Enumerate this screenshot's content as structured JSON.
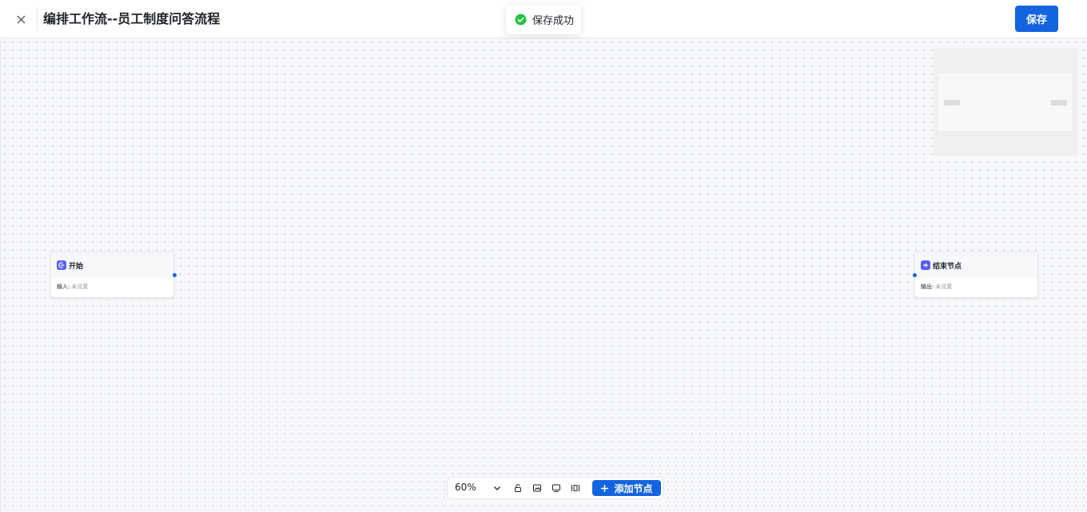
{
  "header": {
    "title": "编排工作流--员工制度问答流程",
    "close_icon": "close-icon",
    "save_label": "保存"
  },
  "toast": {
    "icon": "check-circle-icon",
    "message": "保存成功",
    "color": "#23c343"
  },
  "nodes": {
    "start": {
      "icon": "start-node-icon",
      "title": "开始",
      "field_label": "输入:",
      "field_value": "未设置"
    },
    "end": {
      "icon": "end-node-icon",
      "title": "结束节点",
      "field_label": "输出:",
      "field_value": "未设置"
    }
  },
  "toolbar": {
    "zoom": "60%",
    "icons": [
      "chevron-down-icon",
      "lock-icon",
      "image-export-icon",
      "fit-view-icon",
      "auto-layout-icon",
      "plus-icon"
    ],
    "add_node_label": "添加节点"
  },
  "colors": {
    "primary": "#1464e0",
    "node_icon": "#5b5ff0",
    "success": "#23c343"
  }
}
